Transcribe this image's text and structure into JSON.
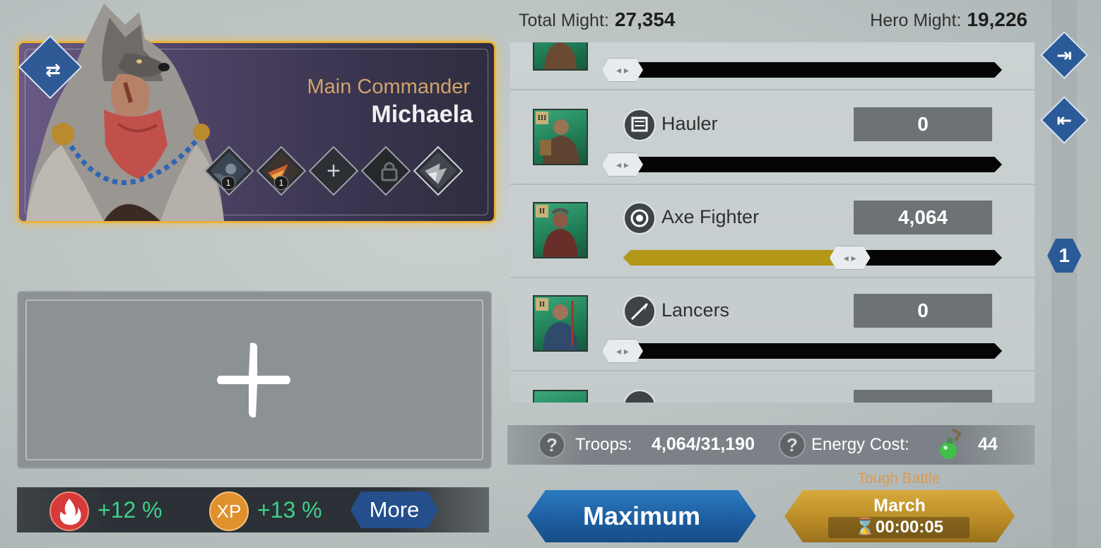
{
  "header": {
    "total_might_label": "Total Might:",
    "total_might_value": "27,354",
    "hero_might_label": "Hero Might:",
    "hero_might_value": "19,226"
  },
  "commander": {
    "role": "Main Commander",
    "name": "Michaela",
    "skills": [
      {
        "icon": "skill-hero-icon",
        "count": "1"
      },
      {
        "icon": "skill-fire-icon",
        "count": "1"
      },
      {
        "icon": "add-skill-icon"
      },
      {
        "icon": "locked-skill-icon"
      },
      {
        "icon": "wolf-skill-icon"
      }
    ]
  },
  "secondary_slot": {
    "icon": "add-commander-icon"
  },
  "bonuses": [
    {
      "icon": "fire-bonus-icon",
      "value": "+12 %",
      "color": "#d63a3a"
    },
    {
      "icon": "xp-bonus-icon",
      "label": "XP",
      "value": "+13 %",
      "color": "#e0902c"
    }
  ],
  "more_button": "More",
  "troops": [
    {
      "name": "",
      "tier": "",
      "count": "",
      "fill": 0
    },
    {
      "name": "Hauler",
      "tier": "III",
      "count": "0",
      "fill": 0
    },
    {
      "name": "Axe Fighter",
      "tier": "II",
      "count": "4,064",
      "fill": 0.6
    },
    {
      "name": "Lancers",
      "tier": "II",
      "count": "0",
      "fill": 0
    }
  ],
  "info": {
    "troops_label": "Troops:",
    "troops_value": "4,064/31,190",
    "energy_label": "Energy Cost:",
    "energy_value": "44"
  },
  "buttons": {
    "maximum": "Maximum",
    "tough_battle": "Tough Battle",
    "march": "March",
    "march_timer": "⌛00:00:05"
  },
  "right_rail": {
    "page_badge": "1"
  },
  "colors": {
    "accent_gold": "#e8b23a",
    "button_blue": "#1d5ea0",
    "bonus_green": "#3fd08a",
    "slider_fill": "#b39716"
  }
}
